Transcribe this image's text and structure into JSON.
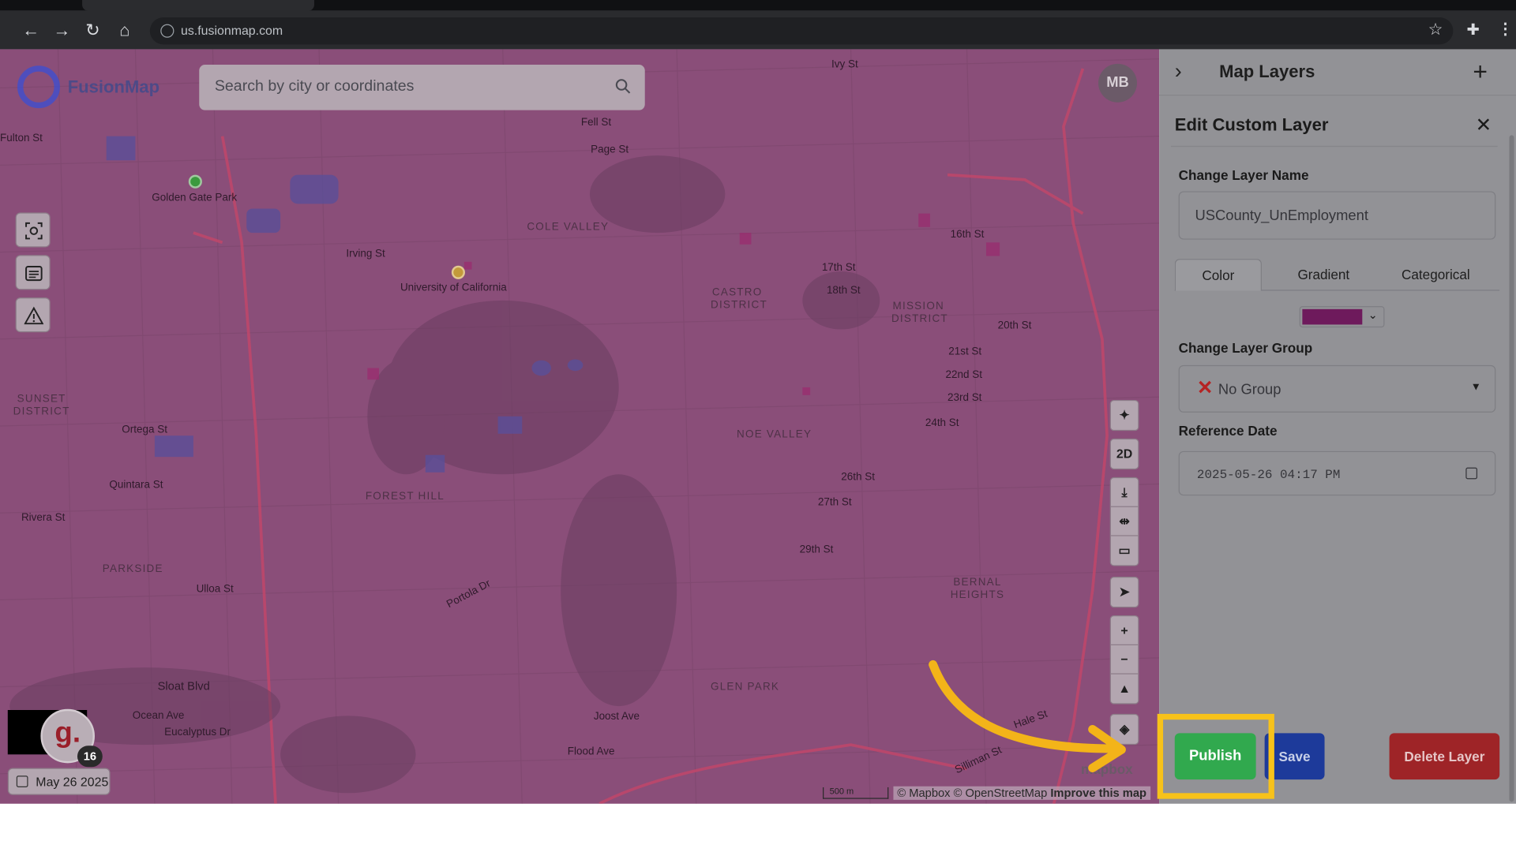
{
  "browser": {
    "url": "us.fusionmap.com"
  },
  "app": {
    "logo_text": "FusionMap",
    "search_placeholder": "Search by city or coordinates",
    "avatar_initials": "MB",
    "date_chip": "May 26 2025",
    "g_count": "16",
    "g_letter": "g.",
    "scale_label": "500 m",
    "attribution": "© Mapbox © OpenStreetMap",
    "attribution_link": "Improve this map",
    "mapbox_watermark": "mapbox",
    "map_controls": {
      "view_mode": "2D"
    }
  },
  "map_labels": [
    {
      "text": "Golden Gate Park"
    },
    {
      "text": "Fulton St"
    },
    {
      "text": "Irving St"
    },
    {
      "text": "University of California"
    },
    {
      "text": "COLE VALLEY"
    },
    {
      "text": "Fell St"
    },
    {
      "text": "Page St"
    },
    {
      "text": "CASTRO DISTRICT"
    },
    {
      "text": "MISSION DISTRICT"
    },
    {
      "text": "NOE VALLEY"
    },
    {
      "text": "FOREST HILL"
    },
    {
      "text": "SUNSET DISTRICT"
    },
    {
      "text": "PARKSIDE"
    },
    {
      "text": "Ortega St"
    },
    {
      "text": "Quintara St"
    },
    {
      "text": "Rivera St"
    },
    {
      "text": "Ulloa St"
    },
    {
      "text": "Sloat Blvd"
    },
    {
      "text": "Ocean Ave"
    },
    {
      "text": "Eucalyptus Dr"
    },
    {
      "text": "Joost Ave"
    },
    {
      "text": "Flood Ave"
    },
    {
      "text": "GLEN PARK"
    },
    {
      "text": "BERNAL HEIGHTS"
    },
    {
      "text": "Portola Dr"
    },
    {
      "text": "16th St"
    },
    {
      "text": "17th St"
    },
    {
      "text": "18th St"
    },
    {
      "text": "20th St"
    },
    {
      "text": "21st St"
    },
    {
      "text": "22nd St"
    },
    {
      "text": "23rd St"
    },
    {
      "text": "24th St"
    },
    {
      "text": "26th St"
    },
    {
      "text": "27th St"
    },
    {
      "text": "29th St"
    },
    {
      "text": "Ivy St"
    },
    {
      "text": "Hale St"
    },
    {
      "text": "Silliman St"
    }
  ],
  "panel": {
    "header_title": "Map Layers",
    "edit_title": "Edit Custom Layer",
    "name_label": "Change Layer Name",
    "name_value": "USCounty_UnEmployment",
    "tabs": [
      "Color",
      "Gradient",
      "Categorical"
    ],
    "active_tab": "Color",
    "color_value": "#6e1a5c",
    "group_label": "Change Layer Group",
    "group_value": "No Group",
    "date_label": "Reference Date",
    "date_value": "2025-05-26 04:17 PM",
    "buttons": {
      "publish": "Publish",
      "save": "Save",
      "delete": "Delete Layer"
    }
  },
  "colors": {
    "map_overlay": "#8a4e79",
    "highlight": "#f7c21a",
    "publish": "#31a94e",
    "save": "#1d3a9a",
    "delete": "#9e2427"
  }
}
